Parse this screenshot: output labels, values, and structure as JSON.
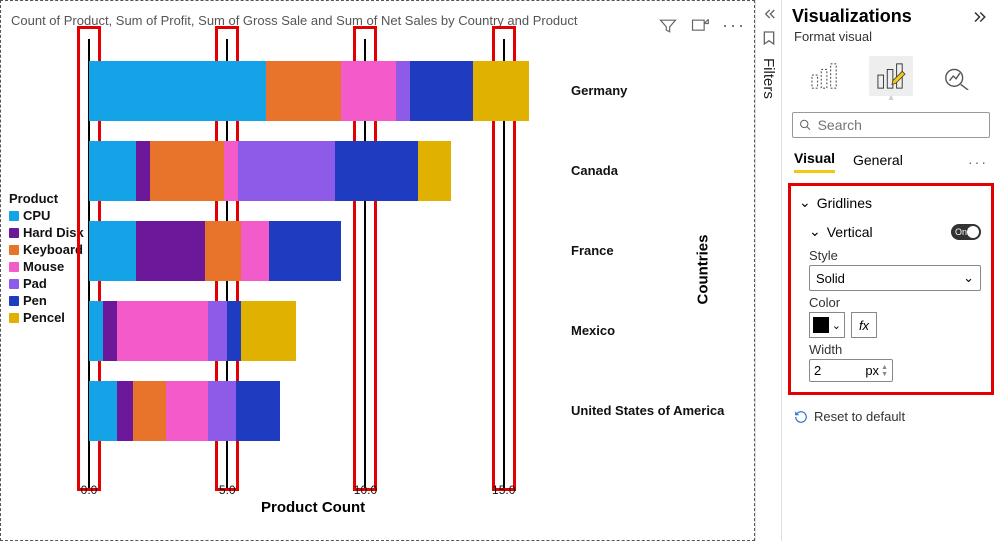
{
  "chart": {
    "title": "Count of Product, Sum of Profit, Sum of Gross Sale and Sum of Net Sales by Country and Product",
    "x_axis_title": "Product Count",
    "y_axis_title": "Countries",
    "x_ticks": [
      "0.0",
      "5.0",
      "10.0",
      "15.0"
    ],
    "legend_title": "Product",
    "legend": [
      {
        "label": "CPU",
        "color": "#15a3e8"
      },
      {
        "label": "Hard Disk",
        "color": "#6b189a"
      },
      {
        "label": "Keyboard",
        "color": "#e8732a"
      },
      {
        "label": "Mouse",
        "color": "#f25bc9"
      },
      {
        "label": "Pad",
        "color": "#8e5be8"
      },
      {
        "label": "Pen",
        "color": "#1f3bc0"
      },
      {
        "label": "Pencel",
        "color": "#e0b100"
      }
    ],
    "categories": [
      "Germany",
      "Canada",
      "France",
      "Mexico",
      "United States of America"
    ]
  },
  "chart_data": {
    "type": "bar",
    "orientation": "horizontal",
    "stacked": true,
    "xlabel": "Product Count",
    "ylabel": "Countries",
    "xlim": [
      0,
      17
    ],
    "x_ticks": [
      0.0,
      5.0,
      10.0,
      15.0
    ],
    "categories": [
      "Germany",
      "Canada",
      "France",
      "Mexico",
      "United States of America"
    ],
    "series": [
      {
        "name": "CPU",
        "color": "#15a3e8",
        "values": [
          6.4,
          1.7,
          1.7,
          0.5,
          1.0
        ]
      },
      {
        "name": "Hard Disk",
        "color": "#6b189a",
        "values": [
          0.0,
          0.5,
          2.5,
          0.5,
          0.6
        ]
      },
      {
        "name": "Keyboard",
        "color": "#e8732a",
        "values": [
          2.7,
          2.7,
          1.3,
          0.0,
          1.2
        ]
      },
      {
        "name": "Mouse",
        "color": "#f25bc9",
        "values": [
          2.0,
          0.5,
          1.0,
          3.3,
          1.5
        ]
      },
      {
        "name": "Pad",
        "color": "#8e5be8",
        "values": [
          0.5,
          3.5,
          0.0,
          0.7,
          1.0
        ]
      },
      {
        "name": "Pen",
        "color": "#1f3bc0",
        "values": [
          2.3,
          3.0,
          2.6,
          0.5,
          1.6
        ]
      },
      {
        "name": "Pencel",
        "color": "#e0b100",
        "values": [
          2.0,
          1.2,
          0.0,
          2.0,
          0.0
        ]
      }
    ]
  },
  "filters": {
    "label": "Filters"
  },
  "panel": {
    "title": "Visualizations",
    "subtitle": "Format visual",
    "search_placeholder": "Search",
    "tabs": {
      "visual": "Visual",
      "general": "General"
    },
    "gridlines": {
      "title": "Gridlines",
      "vertical": {
        "label": "Vertical",
        "toggle": "On"
      },
      "style": {
        "label": "Style",
        "value": "Solid"
      },
      "color": {
        "label": "Color",
        "value": "#000000",
        "fx": "fx"
      },
      "width": {
        "label": "Width",
        "value": "2",
        "unit": "px"
      }
    },
    "reset": "Reset to default"
  }
}
